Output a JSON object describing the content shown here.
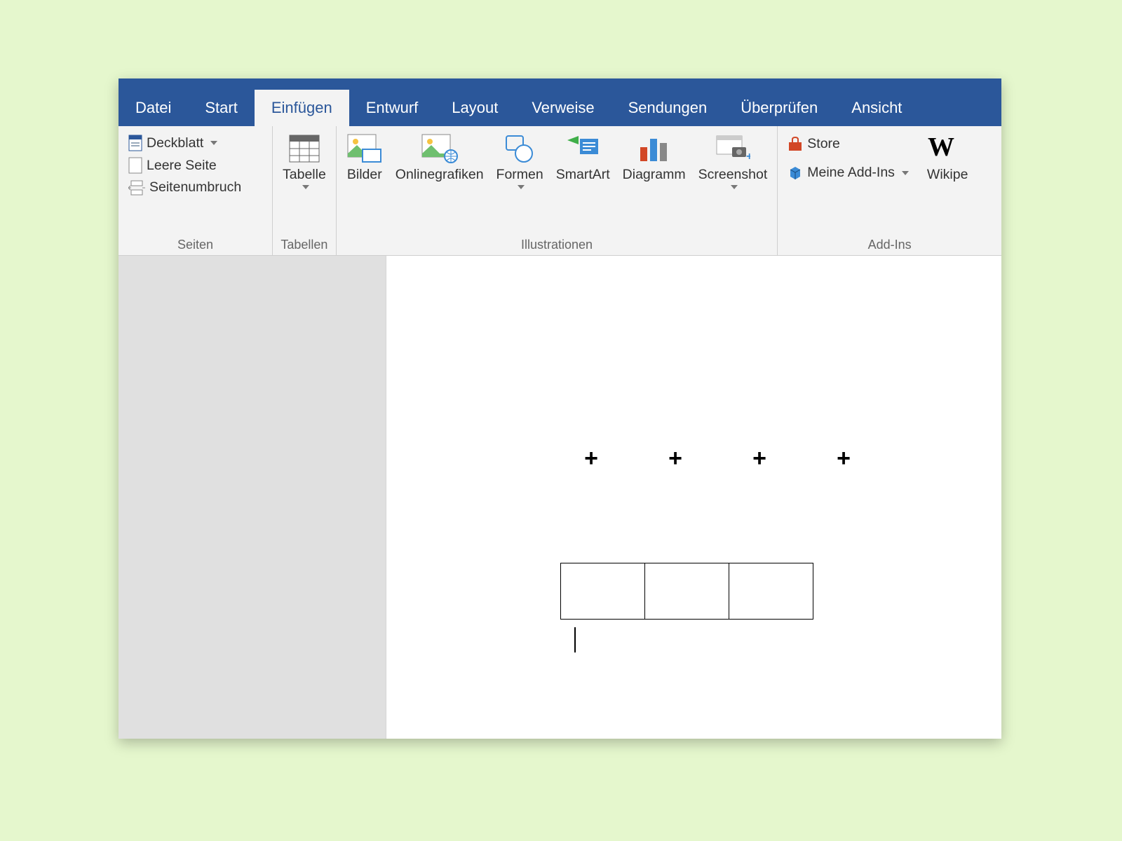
{
  "tabs": [
    "Datei",
    "Start",
    "Einfügen",
    "Entwurf",
    "Layout",
    "Verweise",
    "Sendungen",
    "Überprüfen",
    "Ansicht"
  ],
  "active_tab_index": 2,
  "ribbon": {
    "seiten": {
      "label": "Seiten",
      "deckblatt": "Deckblatt",
      "leere_seite": "Leere Seite",
      "seitenumbruch": "Seitenumbruch"
    },
    "tabellen": {
      "label": "Tabellen",
      "tabelle": "Tabelle"
    },
    "illustrationen": {
      "label": "Illustrationen",
      "bilder": "Bilder",
      "onlinegrafiken": "Onlinegrafiken",
      "formen": "Formen",
      "smartart": "SmartArt",
      "diagramm": "Diagramm",
      "screenshot": "Screenshot"
    },
    "addins": {
      "label": "Add-Ins",
      "store": "Store",
      "meine_addins": "Meine Add-Ins",
      "wikipedia": "Wikipe"
    }
  },
  "document": {
    "plus_marks": [
      "+",
      "+",
      "+",
      "+"
    ],
    "table_cells": [
      "",
      "",
      ""
    ]
  }
}
